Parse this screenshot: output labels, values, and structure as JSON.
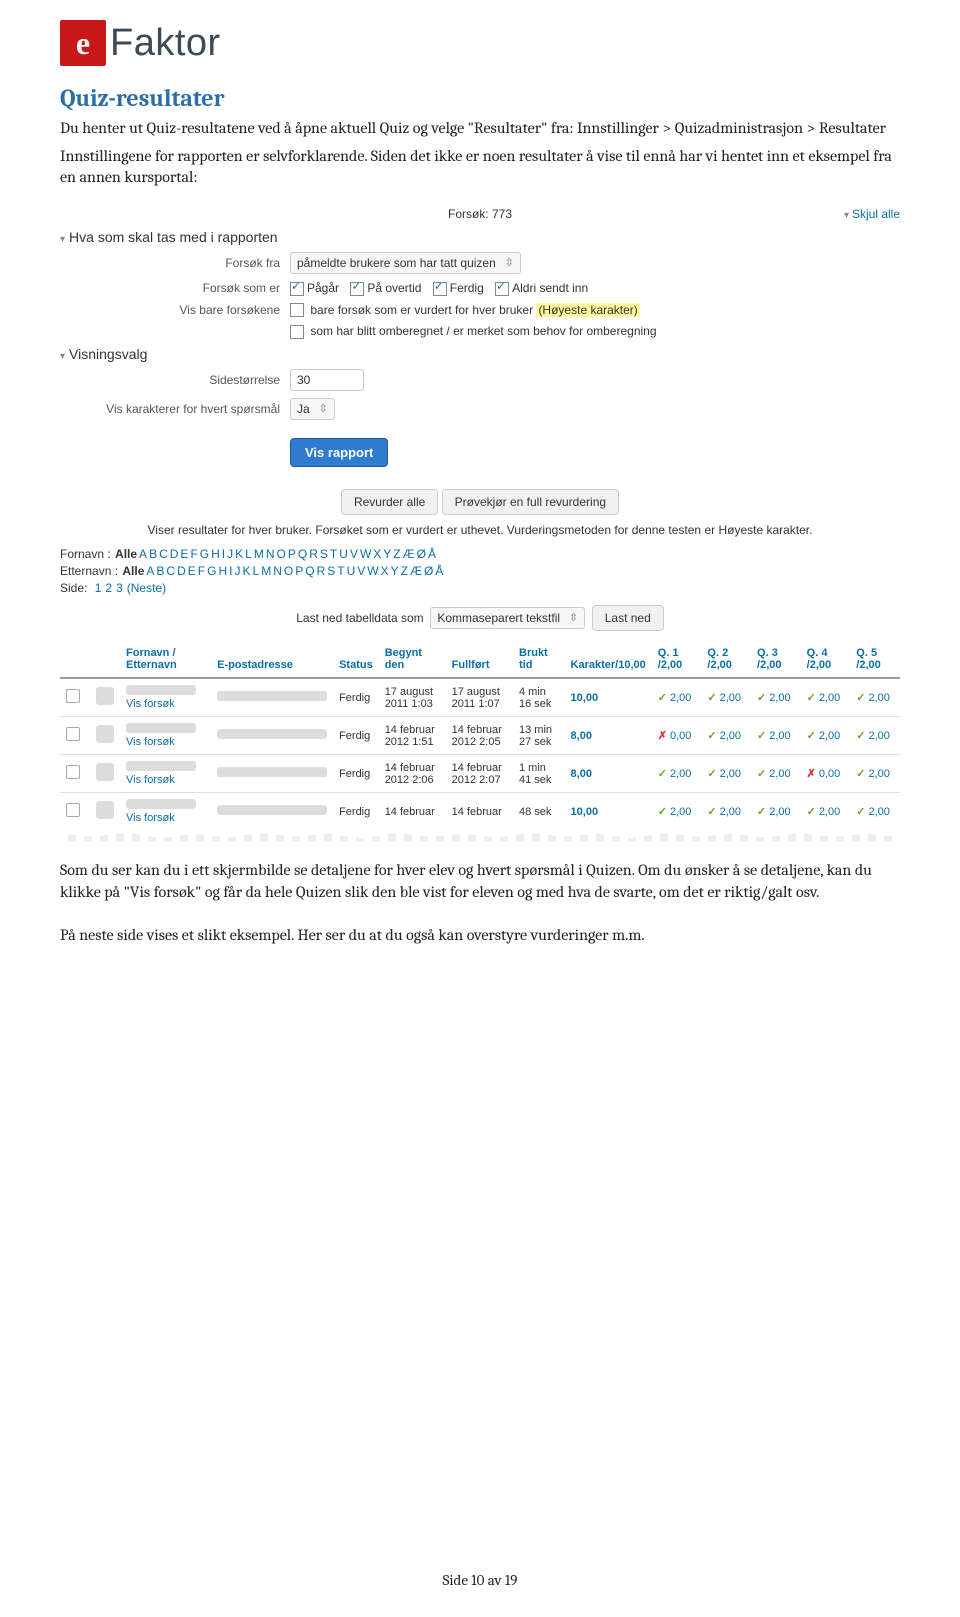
{
  "logo": {
    "mark": "e",
    "text": "Faktor"
  },
  "doc": {
    "heading": "Quiz-resultater",
    "p1": "Du henter ut Quiz-resultatene ved å åpne aktuell Quiz og velge \"Resultater\" fra: Innstillinger > Quizadministrasjon > Resultater",
    "p2": "Innstillingene for rapporten er selvforklarende. Siden det ikke er noen resultater å vise til ennå har vi hentet inn et eksempel fra en annen kursportal:",
    "p3": "Som du ser kan du i ett skjermbilde se detaljene for hver elev og hvert spørsmål i Quizen. Om du ønsker å se detaljene, kan du klikke på \"Vis forsøk\" og får da hele Quizen slik den ble vist for eleven og med hva de svarte, om det er riktig/galt osv.",
    "p4": "På neste side vises et slikt eksempel. Her ser du at du også kan overstyre vurderinger m.m.",
    "footer": "Side 10 av 19"
  },
  "shot": {
    "attempts_label": "Forsøk: 773",
    "skjul": "Skjul alle",
    "section1": "Hva som skal tas med i rapporten",
    "section2": "Visningsvalg",
    "lbl_forsok_fra": "Forsøk fra",
    "sel_forsok_fra": "påmeldte brukere som har tatt quizen",
    "lbl_forsok_som_er": "Forsøk som er",
    "chk_pagar": "Pågår",
    "chk_overtid": "På overtid",
    "chk_ferdig": "Ferdig",
    "chk_aldri": "Aldri sendt inn",
    "lbl_vis_bare": "Vis bare forsøkene",
    "chk_bare_txt": "bare forsøk som er vurdert for hver bruker",
    "chk_bare_hl": "(Høyeste karakter)",
    "chk_omberegnet": "som har blitt omberegnet / er merket som behov for omberegning",
    "lbl_side": "Sidestørrelse",
    "val_side": "30",
    "lbl_vis_kar": "Vis karakterer for hvert spørsmål",
    "val_vis_kar": "Ja",
    "btn_vis": "Vis rapport",
    "btn_revurder": "Revurder alle",
    "btn_provekjor": "Prøvekjør en full revurdering",
    "result_note": "Viser resultater for hver bruker. Forsøket som er vurdert er uthevet. Vurderingsmetoden for denne testen er Høyeste karakter.",
    "alpha_fornavn_pre": "Fornavn : ",
    "alpha_etternavn_pre": "Etternavn : ",
    "alpha_all": "Alle",
    "alpha_letters": [
      "A",
      "B",
      "C",
      "D",
      "E",
      "F",
      "G",
      "H",
      "I",
      "J",
      "K",
      "L",
      "M",
      "N",
      "O",
      "P",
      "Q",
      "R",
      "S",
      "T",
      "U",
      "V",
      "W",
      "X",
      "Y",
      "Z",
      "Æ",
      "Ø",
      "Å"
    ],
    "pager_pre": "Side: ",
    "pager_pages": [
      "1",
      "2",
      "3",
      "(Neste)"
    ],
    "dl_lbl": "Last ned tabelldata som",
    "dl_sel": "Kommaseparert tekstfil",
    "dl_btn": "Last ned",
    "th": {
      "name": "Fornavn / Etternavn",
      "email": "E-postadresse",
      "status": "Status",
      "begynt": "Begynt den",
      "fullfort": "Fullført",
      "brukt": "Brukt tid",
      "kar": "Karakter/10,00",
      "q1": "Q. 1 /2,00",
      "q2": "Q. 2 /2,00",
      "q3": "Q. 3 /2,00",
      "q4": "Q. 4 /2,00",
      "q5": "Q. 5 /2,00"
    },
    "vis_forsok": "Vis forsøk",
    "rows": [
      {
        "status": "Ferdig",
        "begynt": "17 august 2011 1:03",
        "fullfort": "17 august 2011 1:07",
        "brukt": "4 min 16 sek",
        "kar": "10,00",
        "q": [
          "ok 2,00",
          "ok 2,00",
          "ok 2,00",
          "ok 2,00",
          "ok 2,00"
        ]
      },
      {
        "status": "Ferdig",
        "begynt": "14 februar 2012 1:51",
        "fullfort": "14 februar 2012 2:05",
        "brukt": "13 min 27 sek",
        "kar": "8,00",
        "q": [
          "bad 0,00",
          "ok 2,00",
          "ok 2,00",
          "ok 2,00",
          "ok 2,00"
        ]
      },
      {
        "status": "Ferdig",
        "begynt": "14 februar 2012 2:06",
        "fullfort": "14 februar 2012 2:07",
        "brukt": "1 min 41 sek",
        "kar": "8,00",
        "q": [
          "ok 2,00",
          "ok 2,00",
          "ok 2,00",
          "bad 0,00",
          "ok 2,00"
        ]
      },
      {
        "status": "Ferdig",
        "begynt": "14 februar",
        "fullfort": "14 februar",
        "brukt": "48 sek",
        "kar": "10,00",
        "q": [
          "ok 2,00",
          "ok 2,00",
          "ok 2,00",
          "ok 2,00",
          "ok 2,00"
        ]
      }
    ]
  }
}
